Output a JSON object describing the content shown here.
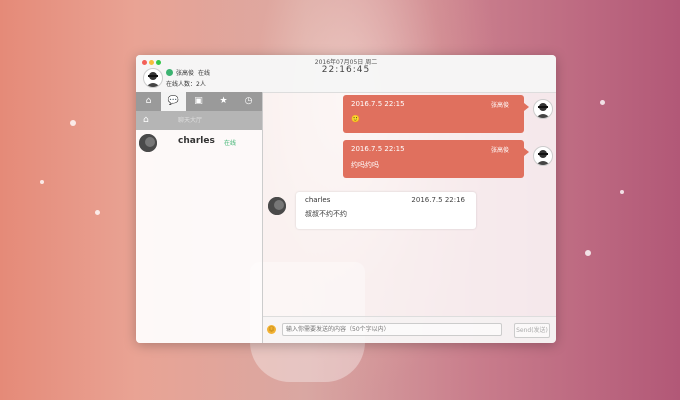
{
  "header": {
    "date": "2016年07月05日 周二",
    "clock": "22:16:45",
    "user_name": "张高俊",
    "user_status": "在线",
    "online_count": "在线人数：2人"
  },
  "sidebar": {
    "tabs": [
      {
        "icon": "home-icon",
        "glyph": "⌂"
      },
      {
        "icon": "chat-icon",
        "glyph": "💬"
      },
      {
        "icon": "contacts-icon",
        "glyph": "▣"
      },
      {
        "icon": "star-icon",
        "glyph": "★"
      },
      {
        "icon": "history-icon",
        "glyph": "◷"
      }
    ],
    "section_label": "聊天大厅",
    "contacts": [
      {
        "name": "charles",
        "status": "在线"
      }
    ]
  },
  "messages": [
    {
      "direction": "out",
      "time": "2016.7.5 22:15",
      "sender": "张高俊",
      "text": "🙂"
    },
    {
      "direction": "out",
      "time": "2016.7.5 22:15",
      "sender": "张高俊",
      "text": "约吗约吗"
    },
    {
      "direction": "in",
      "time": "2016.7.5 22:16",
      "sender": "charles",
      "text": "叔叔不约不约"
    }
  ],
  "input": {
    "placeholder": "输入你需要发送的内容（50个字以内）",
    "send_label": "Send(发送)"
  },
  "colors": {
    "accent": "#e0705e",
    "online": "#3cb371",
    "tab_bar": "#9a9a9a"
  }
}
